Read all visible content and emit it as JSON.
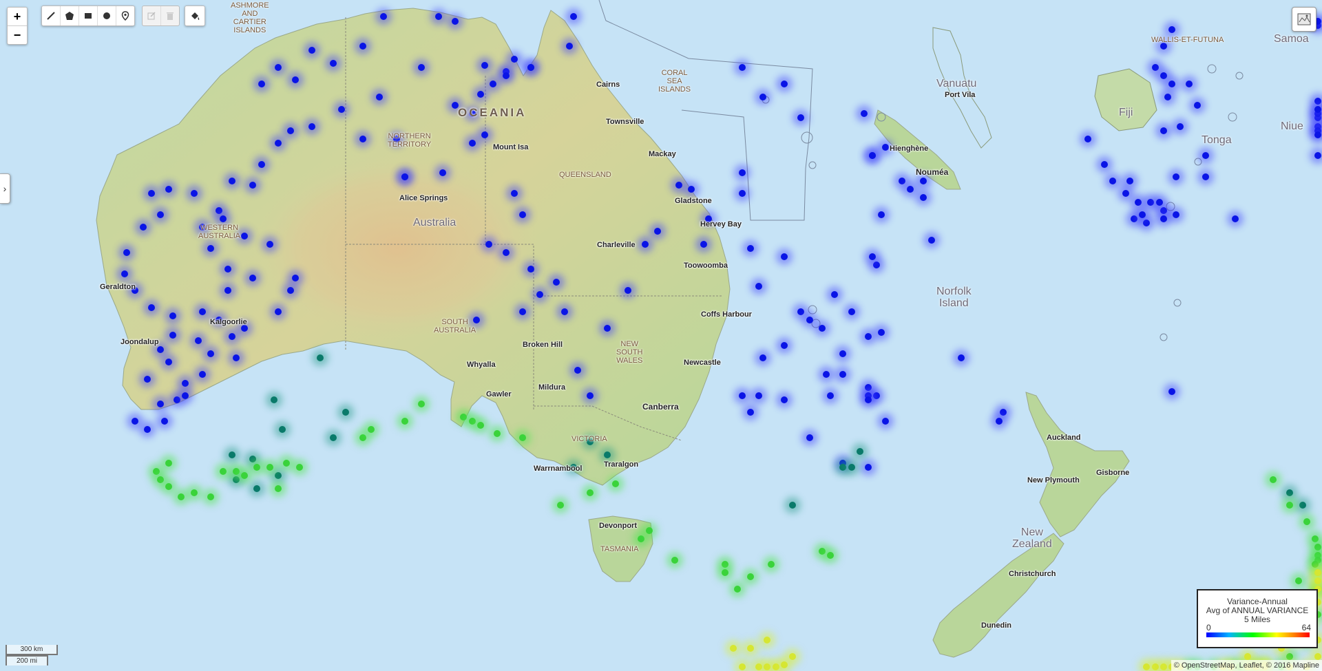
{
  "controls": {
    "zoom_in": "+",
    "zoom_out": "−",
    "draw_tools": [
      "polyline-icon",
      "polygon-icon",
      "rectangle-icon",
      "circle-icon",
      "marker-icon"
    ],
    "edit_tools": [
      "edit-icon",
      "trash-icon"
    ],
    "fill_tool": "paint-bucket-icon",
    "layers_tool": "map-layers-icon",
    "side_panel_toggle": "›"
  },
  "labels": {
    "continent": "OCEANIA",
    "countries": {
      "australia": "Australia",
      "vanuatu": "Vanuatu",
      "fiji": "Fiji",
      "tonga": "Tonga",
      "niue": "Niue",
      "samoa": "Samoa",
      "norfolk": "Norfolk\nIsland",
      "new_zealand": "New\nZealand"
    },
    "regions": {
      "ashmore": "ASHMORE\nAND\nCARTIER\nISLANDS",
      "coral_sea": "CORAL\nSEA\nISLANDS",
      "wallis": "WALLIS-ET-FUTUNA",
      "nt": "NORTHERN\nTERRITORY",
      "qld": "QUEENSLAND",
      "wa": "WESTERN\nAUSTRALIA",
      "sa": "SOUTH\nAUSTRALIA",
      "nsw": "NEW\nSOUTH\nWALES",
      "vic": "VICTORIA",
      "tas": "TASMANIA"
    },
    "cities": {
      "cairns": "Cairns",
      "townsville": "Townsville",
      "mount_isa": "Mount Isa",
      "mackay": "Mackay",
      "gladstone": "Gladstone",
      "hervey_bay": "Hervey Bay",
      "alice_springs": "Alice Springs",
      "charleville": "Charleville",
      "toowoomba": "Toowoomba",
      "geraldton": "Geraldton",
      "kalgoorlie": "Kalgoorlie",
      "joondalup": "Joondalup",
      "coffs_harbour": "Coffs Harbour",
      "broken_hill": "Broken Hill",
      "newcastle": "Newcastle",
      "whyalla": "Whyalla",
      "gawler": "Gawler",
      "mildura": "Mildura",
      "canberra": "Canberra",
      "warrnambool": "Warrnambool",
      "traralgon": "Traralgon",
      "devonport": "Devonport",
      "port_vila": "Port Vila",
      "hienghene": "Hienghène",
      "noumea": "Nouméa",
      "auckland": "Auckland",
      "new_plymouth": "New Plymouth",
      "gisborne": "Gisborne",
      "christchurch": "Christchurch",
      "dunedin": "Dunedin"
    }
  },
  "legend": {
    "title": "Variance-Annual",
    "subtitle": "Avg of ANNUAL VARIANCE",
    "radius": "5 Miles",
    "min": "0",
    "max": "64"
  },
  "scale": {
    "km": "300 km",
    "mi": "200 mi"
  },
  "attribution": "© OpenStreetMap, Leaflet, © 2016 Mapline",
  "points": {
    "blue": [
      [
        275,
        215
      ],
      [
        310,
        100
      ],
      [
        330,
        80
      ],
      [
        350,
        95
      ],
      [
        370,
        60
      ],
      [
        395,
        75
      ],
      [
        430,
        55
      ],
      [
        455,
        20
      ],
      [
        520,
        20
      ],
      [
        540,
        25
      ],
      [
        575,
        78
      ],
      [
        600,
        85
      ],
      [
        630,
        80
      ],
      [
        680,
        20
      ],
      [
        675,
        55
      ],
      [
        540,
        125
      ],
      [
        560,
        135
      ],
      [
        570,
        112
      ],
      [
        585,
        100
      ],
      [
        600,
        90
      ],
      [
        610,
        70
      ],
      [
        575,
        160
      ],
      [
        560,
        170
      ],
      [
        525,
        205
      ],
      [
        480,
        210
      ],
      [
        470,
        165
      ],
      [
        430,
        165
      ],
      [
        450,
        115
      ],
      [
        405,
        130
      ],
      [
        370,
        150
      ],
      [
        345,
        155
      ],
      [
        330,
        170
      ],
      [
        310,
        195
      ],
      [
        300,
        220
      ],
      [
        260,
        250
      ],
      [
        230,
        230
      ],
      [
        200,
        225
      ],
      [
        180,
        230
      ],
      [
        190,
        255
      ],
      [
        170,
        270
      ],
      [
        150,
        300
      ],
      [
        148,
        325
      ],
      [
        160,
        345
      ],
      [
        180,
        365
      ],
      [
        205,
        375
      ],
      [
        240,
        370
      ],
      [
        260,
        380
      ],
      [
        275,
        400
      ],
      [
        290,
        390
      ],
      [
        330,
        370
      ],
      [
        345,
        345
      ],
      [
        350,
        330
      ],
      [
        320,
        290
      ],
      [
        290,
        280
      ],
      [
        265,
        260
      ],
      [
        240,
        270
      ],
      [
        250,
        295
      ],
      [
        270,
        320
      ],
      [
        300,
        330
      ],
      [
        270,
        345
      ],
      [
        280,
        425
      ],
      [
        250,
        420
      ],
      [
        240,
        445
      ],
      [
        220,
        455
      ],
      [
        210,
        475
      ],
      [
        190,
        480
      ],
      [
        195,
        500
      ],
      [
        175,
        510
      ],
      [
        160,
        500
      ],
      [
        175,
        450
      ],
      [
        200,
        430
      ],
      [
        190,
        415
      ],
      [
        205,
        398
      ],
      [
        235,
        405
      ],
      [
        220,
        470
      ],
      [
        480,
        210
      ],
      [
        500,
        80
      ],
      [
        630,
        80
      ],
      [
        610,
        230
      ],
      [
        620,
        255
      ],
      [
        600,
        300
      ],
      [
        580,
        290
      ],
      [
        630,
        320
      ],
      [
        660,
        335
      ],
      [
        640,
        350
      ],
      [
        620,
        370
      ],
      [
        565,
        380
      ],
      [
        670,
        370
      ],
      [
        685,
        440
      ],
      [
        700,
        470
      ],
      [
        720,
        390
      ],
      [
        745,
        345
      ],
      [
        765,
        290
      ],
      [
        780,
        275
      ],
      [
        805,
        220
      ],
      [
        820,
        225
      ],
      [
        840,
        260
      ],
      [
        835,
        290
      ],
      [
        880,
        205
      ],
      [
        890,
        295
      ],
      [
        880,
        230
      ],
      [
        900,
        340
      ],
      [
        930,
        305
      ],
      [
        930,
        410
      ],
      [
        950,
        370
      ],
      [
        960,
        380
      ],
      [
        990,
        350
      ],
      [
        1010,
        370
      ],
      [
        1040,
        315
      ],
      [
        1000,
        445
      ],
      [
        1030,
        460
      ],
      [
        1040,
        470
      ],
      [
        1030,
        470
      ],
      [
        930,
        475
      ],
      [
        890,
        490
      ],
      [
        1030,
        400
      ],
      [
        1000,
        420
      ],
      [
        1030,
        475
      ],
      [
        880,
        80
      ],
      [
        905,
        115
      ],
      [
        950,
        140
      ],
      [
        1025,
        135
      ],
      [
        1035,
        185
      ],
      [
        1050,
        175
      ],
      [
        1070,
        215
      ],
      [
        1045,
        255
      ],
      [
        1095,
        235
      ],
      [
        1095,
        215
      ],
      [
        1080,
        225
      ],
      [
        1045,
        395
      ],
      [
        980,
        445
      ],
      [
        1000,
        550
      ],
      [
        1030,
        555
      ],
      [
        1050,
        500
      ],
      [
        905,
        425
      ],
      [
        900,
        470
      ],
      [
        880,
        470
      ],
      [
        930,
        100
      ],
      [
        1035,
        185
      ],
      [
        1035,
        305
      ],
      [
        960,
        520
      ],
      [
        985,
        470
      ],
      [
        975,
        390
      ],
      [
        1105,
        285
      ],
      [
        1190,
        490
      ],
      [
        1385,
        115
      ],
      [
        1380,
        155
      ],
      [
        1370,
        80
      ],
      [
        1380,
        90
      ],
      [
        1390,
        100
      ],
      [
        1410,
        100
      ],
      [
        1420,
        125
      ],
      [
        1400,
        150
      ],
      [
        1430,
        185
      ],
      [
        1290,
        165
      ],
      [
        1310,
        195
      ],
      [
        1320,
        215
      ],
      [
        1340,
        215
      ],
      [
        1350,
        240
      ],
      [
        1345,
        260
      ],
      [
        1360,
        265
      ],
      [
        1365,
        240
      ],
      [
        1380,
        250
      ],
      [
        1395,
        210
      ],
      [
        1395,
        255
      ],
      [
        1380,
        260
      ],
      [
        1355,
        255
      ],
      [
        1335,
        230
      ],
      [
        1375,
        240
      ],
      [
        1430,
        210
      ],
      [
        1465,
        260
      ],
      [
        1600,
        150
      ],
      [
        1610,
        140
      ],
      [
        1625,
        135
      ],
      [
        1620,
        155
      ],
      [
        1615,
        120
      ],
      [
        1625,
        160
      ],
      [
        1640,
        130
      ],
      [
        1655,
        185
      ],
      [
        1595,
        30
      ],
      [
        1390,
        465
      ],
      [
        1380,
        55
      ],
      [
        1625,
        25
      ],
      [
        1390,
        35
      ],
      [
        1185,
        500
      ],
      [
        1140,
        425
      ]
    ],
    "teal": [
      [
        1000,
        555
      ],
      [
        1010,
        555
      ],
      [
        940,
        600
      ],
      [
        700,
        525
      ],
      [
        680,
        555
      ],
      [
        720,
        540
      ],
      [
        380,
        425
      ],
      [
        325,
        475
      ],
      [
        410,
        490
      ],
      [
        395,
        520
      ],
      [
        335,
        510
      ],
      [
        300,
        545
      ],
      [
        330,
        565
      ],
      [
        275,
        540
      ],
      [
        280,
        570
      ],
      [
        305,
        580
      ],
      [
        1020,
        536
      ],
      [
        1530,
        585
      ],
      [
        1545,
        600
      ]
    ],
    "green": [
      [
        500,
        480
      ],
      [
        550,
        495
      ],
      [
        480,
        500
      ],
      [
        430,
        520
      ],
      [
        440,
        510
      ],
      [
        560,
        500
      ],
      [
        570,
        505
      ],
      [
        590,
        515
      ],
      [
        620,
        520
      ],
      [
        200,
        550
      ],
      [
        185,
        560
      ],
      [
        190,
        570
      ],
      [
        200,
        578
      ],
      [
        215,
        590
      ],
      [
        230,
        585
      ],
      [
        250,
        590
      ],
      [
        265,
        560
      ],
      [
        280,
        560
      ],
      [
        305,
        555
      ],
      [
        320,
        555
      ],
      [
        340,
        550
      ],
      [
        355,
        555
      ],
      [
        290,
        565
      ],
      [
        330,
        580
      ],
      [
        760,
        640
      ],
      [
        800,
        665
      ],
      [
        860,
        670
      ],
      [
        875,
        700
      ],
      [
        890,
        685
      ],
      [
        915,
        670
      ],
      [
        975,
        655
      ],
      [
        985,
        660
      ],
      [
        665,
        600
      ],
      [
        700,
        585
      ],
      [
        730,
        575
      ],
      [
        770,
        630
      ],
      [
        860,
        680
      ],
      [
        1510,
        570
      ],
      [
        1530,
        600
      ],
      [
        1550,
        620
      ],
      [
        1560,
        640
      ],
      [
        1580,
        650
      ],
      [
        1600,
        660
      ],
      [
        1620,
        665
      ],
      [
        1625,
        680
      ],
      [
        1590,
        700
      ],
      [
        1570,
        730
      ],
      [
        1550,
        760
      ],
      [
        1530,
        780
      ],
      [
        1500,
        810
      ],
      [
        1480,
        830
      ],
      [
        1460,
        850
      ],
      [
        1440,
        870
      ],
      [
        1420,
        890
      ],
      [
        1410,
        910
      ],
      [
        1470,
        900
      ],
      [
        1490,
        880
      ],
      [
        1520,
        860
      ],
      [
        1560,
        670
      ],
      [
        1540,
        690
      ],
      [
        1620,
        700
      ]
    ],
    "yellow": [
      [
        870,
        770
      ],
      [
        880,
        800
      ],
      [
        900,
        810
      ],
      [
        910,
        820
      ],
      [
        920,
        830
      ],
      [
        930,
        790
      ],
      [
        940,
        780
      ],
      [
        910,
        760
      ],
      [
        890,
        770
      ],
      [
        1380,
        910
      ],
      [
        1400,
        920
      ],
      [
        1390,
        930
      ],
      [
        1370,
        935
      ],
      [
        1360,
        920
      ],
      [
        1460,
        830
      ],
      [
        1450,
        850
      ],
      [
        1480,
        840
      ],
      [
        1490,
        810
      ],
      [
        1500,
        790
      ],
      [
        1520,
        770
      ],
      [
        1540,
        760
      ],
      [
        1555,
        740
      ],
      [
        1570,
        715
      ],
      [
        1585,
        700
      ],
      [
        1600,
        690
      ],
      [
        1570,
        680
      ],
      [
        1520,
        740
      ],
      [
        1500,
        760
      ],
      [
        1480,
        780
      ],
      [
        1500,
        830
      ],
      [
        1530,
        820
      ],
      [
        1550,
        800
      ],
      [
        1565,
        780
      ],
      [
        1580,
        760
      ]
    ]
  }
}
